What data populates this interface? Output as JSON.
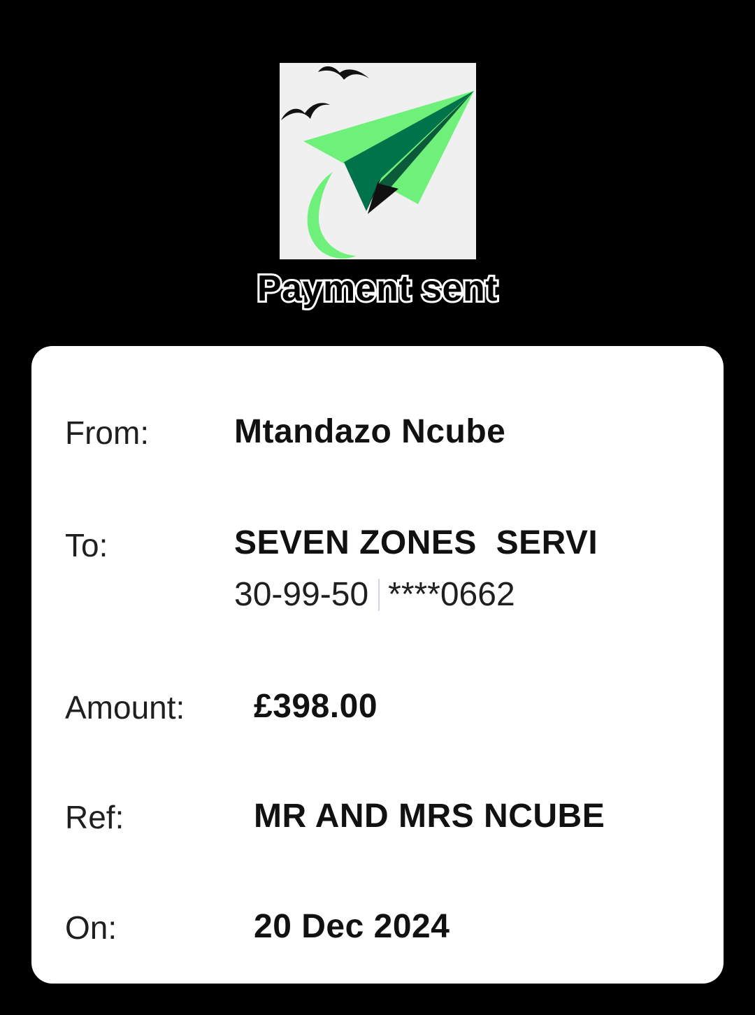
{
  "header": {
    "title": "Payment sent",
    "logo_icon": "paper-plane-with-birds-icon",
    "brand_colors": {
      "light_green": "#6ef07a",
      "dark_green": "#00734a",
      "logo_background": "#f0f0f0"
    }
  },
  "details": {
    "from": {
      "label": "From:",
      "value": "Mtandazo Ncube"
    },
    "to": {
      "label": "To:",
      "value": "SEVEN ZONES  SERVI",
      "sort_code": "30-99-50",
      "account_number": "****0662"
    },
    "amount": {
      "label": "Amount:",
      "value": "£398.00"
    },
    "ref": {
      "label": "Ref:",
      "value": "MR AND MRS NCUBE"
    },
    "on": {
      "label": "On:",
      "value": "20 Dec 2024"
    }
  }
}
